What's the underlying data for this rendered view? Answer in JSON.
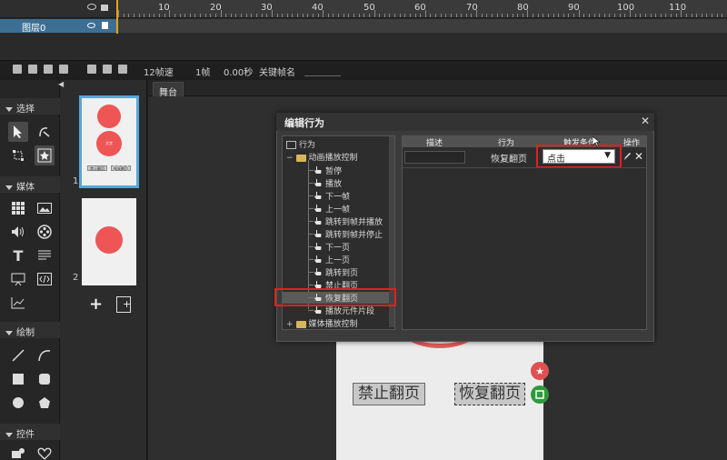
{
  "timeline": {
    "ruler_labels": [
      "10",
      "20",
      "30",
      "40",
      "50",
      "60",
      "70",
      "80",
      "90",
      "100",
      "110"
    ],
    "layer_name": "图层0",
    "toolbar": {
      "fps": "12帧速",
      "frame": "1帧",
      "time": "0.00秒",
      "keyframe_name_label": "关键帧名"
    }
  },
  "tools": {
    "section_select": "选择",
    "section_media": "媒体",
    "section_draw": "绘制",
    "section_controls": "控件"
  },
  "pages": {
    "thumb1_circle_text": "文字",
    "thumb1_btn1": "禁止翻页",
    "thumb1_btn2": "恢复翻页",
    "page1_num": "1",
    "page2_num": "2",
    "add_label": "+"
  },
  "stage": {
    "tab_label": "舞台",
    "button_disable": "禁止翻页",
    "button_resume": "恢复翻页"
  },
  "dialog": {
    "title": "编辑行为",
    "close": "✕",
    "tree": {
      "root": "行为",
      "group1": "动画播放控制",
      "items": [
        "暂停",
        "播放",
        "下一帧",
        "上一帧",
        "跳转到帧并播放",
        "跳转到帧并停止",
        "下一页",
        "上一页",
        "跳转到页",
        "禁止翻页",
        "恢复翻页",
        "播放元件片段"
      ],
      "group2": "媒体播放控制"
    },
    "table": {
      "headers": [
        "描述",
        "行为",
        "触发条件",
        "操作"
      ],
      "row": {
        "description": "",
        "action": "恢复翻页",
        "trigger": "点击"
      }
    }
  },
  "colors": {
    "accent_blue": "#56a7d6",
    "highlight_red": "#e02020",
    "circle_red": "#ee5555",
    "playhead": "#e8a317"
  }
}
